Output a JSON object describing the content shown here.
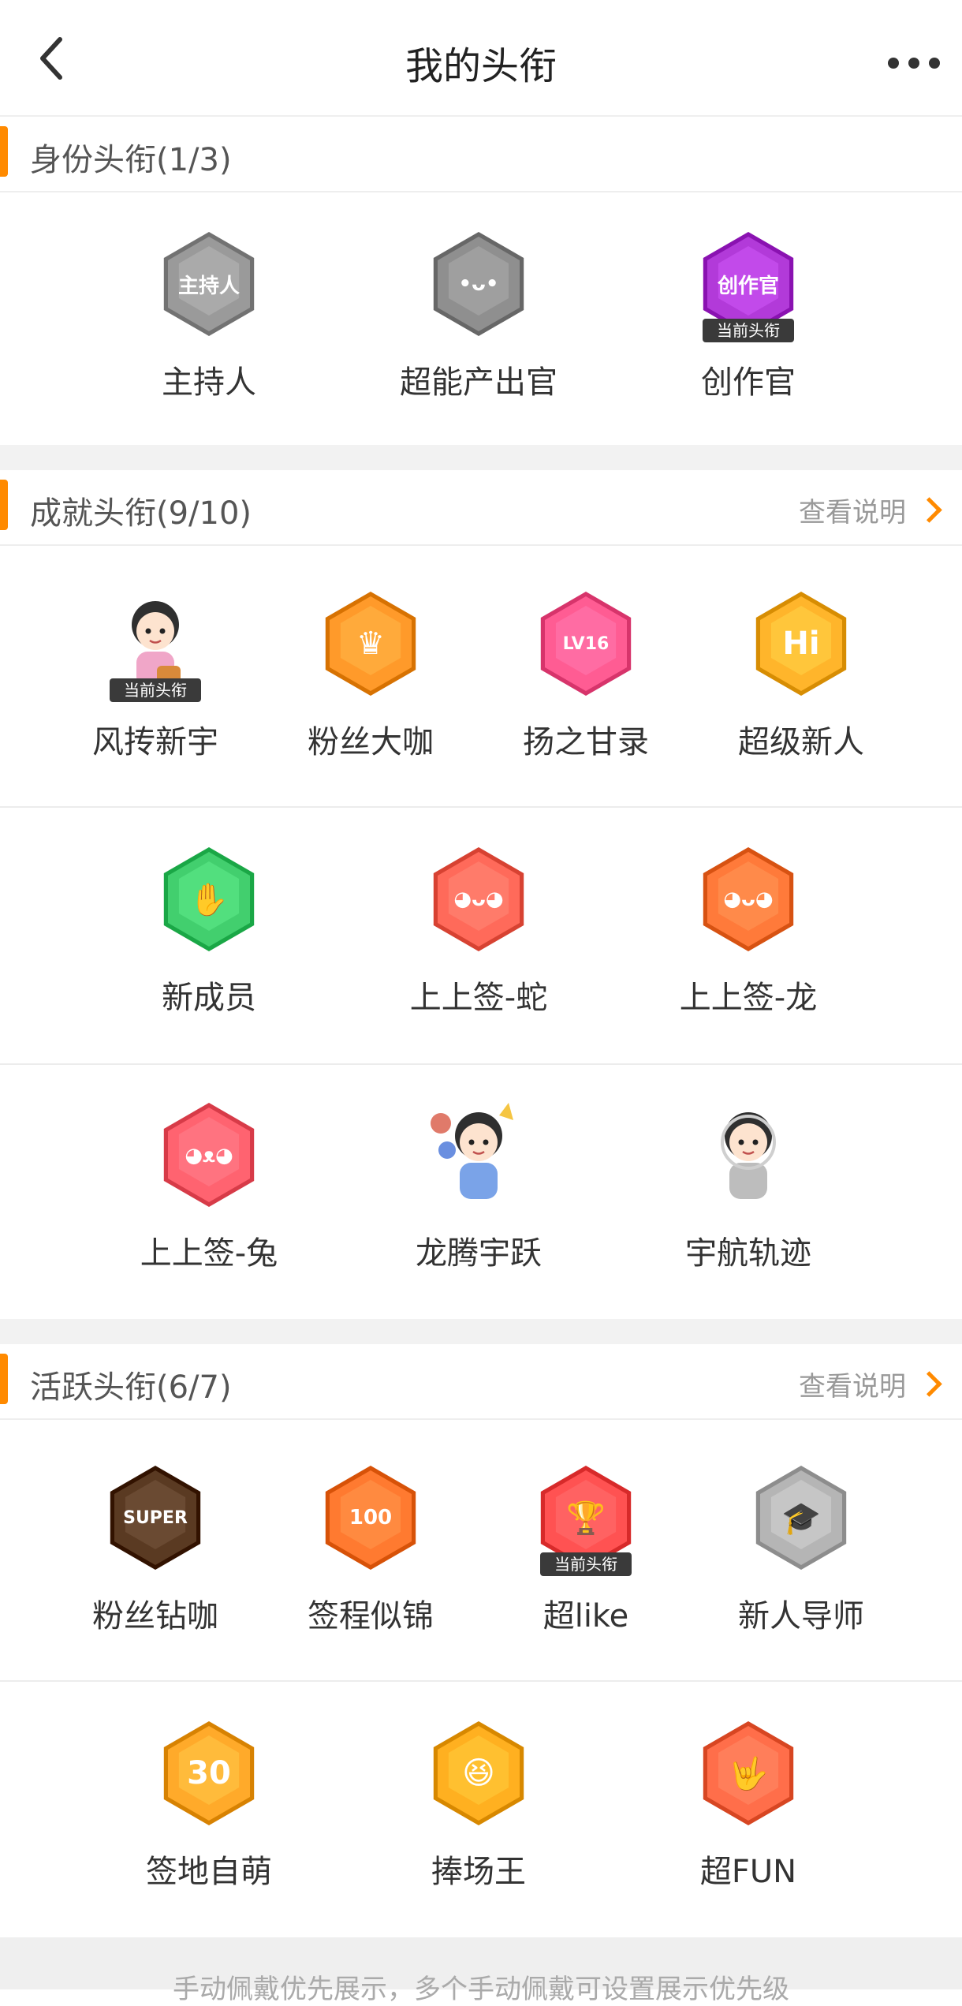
{
  "header": {
    "title": "我的头衔"
  },
  "sections": {
    "identity": {
      "label": "身份头衔(1/3)",
      "items": [
        {
          "name": "主持人",
          "icon": "microphone-icon",
          "color": "#9a9a9a",
          "current": false,
          "glyph": "主持人"
        },
        {
          "name": "超能产出官",
          "icon": "blob-icon",
          "color": "#8f8f8f",
          "current": false,
          "glyph": "•ᴗ•"
        },
        {
          "name": "创作官",
          "icon": "creator-icon",
          "color": "#b23ad9",
          "current": true,
          "glyph": "创作官"
        }
      ]
    },
    "achievement": {
      "label": "成就头衔(9/10)",
      "link": "查看说明",
      "items": [
        {
          "name": "风抟新宇",
          "icon": "avatar-boy-icon",
          "color": "#f0a6c8",
          "current": true,
          "glyph": ""
        },
        {
          "name": "粉丝大咖",
          "icon": "crown-icon",
          "color": "#ff9a2a",
          "current": false,
          "glyph": "♛"
        },
        {
          "name": "扬之甘录",
          "icon": "lv16-icon",
          "color": "#ff5c93",
          "current": false,
          "glyph": "LV16"
        },
        {
          "name": "超级新人",
          "icon": "hi-icon",
          "color": "#ffb52b",
          "current": false,
          "glyph": "Hi"
        },
        {
          "name": "新成员",
          "icon": "hand-icon",
          "color": "#42cf6e",
          "current": false,
          "glyph": "✋"
        },
        {
          "name": "上上签-蛇",
          "icon": "snake-icon",
          "color": "#ff6a5a",
          "current": false,
          "glyph": "◕ᴗ◕"
        },
        {
          "name": "上上签-龙",
          "icon": "dragon-icon",
          "color": "#ff7a3a",
          "current": false,
          "glyph": "◕ᴗ◕"
        },
        {
          "name": "上上签-兔",
          "icon": "rabbit-icon",
          "color": "#ff6370",
          "current": false,
          "glyph": "◕ᴥ◕"
        },
        {
          "name": "龙腾宇跃",
          "icon": "birthday-boy-icon",
          "color": "#7aa3e8",
          "current": false,
          "glyph": ""
        },
        {
          "name": "宇航轨迹",
          "icon": "astronaut-icon",
          "color": "#bdbdbd",
          "current": false,
          "glyph": ""
        }
      ]
    },
    "activity": {
      "label": "活跃头衔(6/7)",
      "link": "查看说明",
      "items": [
        {
          "name": "粉丝钻咖",
          "icon": "super-crown-icon",
          "color": "#5a3a22",
          "current": false,
          "glyph": "SUPER"
        },
        {
          "name": "签程似锦",
          "icon": "100-days-icon",
          "color": "#ff7a30",
          "current": false,
          "glyph": "100"
        },
        {
          "name": "超like",
          "icon": "trophy-icon",
          "color": "#ff5252",
          "current": true,
          "glyph": "🏆"
        },
        {
          "name": "新人导师",
          "icon": "graduation-cap-icon",
          "color": "#b5b5b5",
          "current": false,
          "glyph": "🎓"
        },
        {
          "name": "签地自萌",
          "icon": "30-days-icon",
          "color": "#ffaa2a",
          "current": false,
          "glyph": "30"
        },
        {
          "name": "捧场王",
          "icon": "cheering-face-icon",
          "color": "#ffb020",
          "current": false,
          "glyph": "😆"
        },
        {
          "name": "超FUN",
          "icon": "rock-hand-icon",
          "color": "#ff6e4a",
          "current": false,
          "glyph": "🤟"
        }
      ]
    }
  },
  "current_tag": "当前头衔",
  "footer": {
    "text": "手动佩戴优先展示，多个手动佩戴可设置展示优先级"
  }
}
